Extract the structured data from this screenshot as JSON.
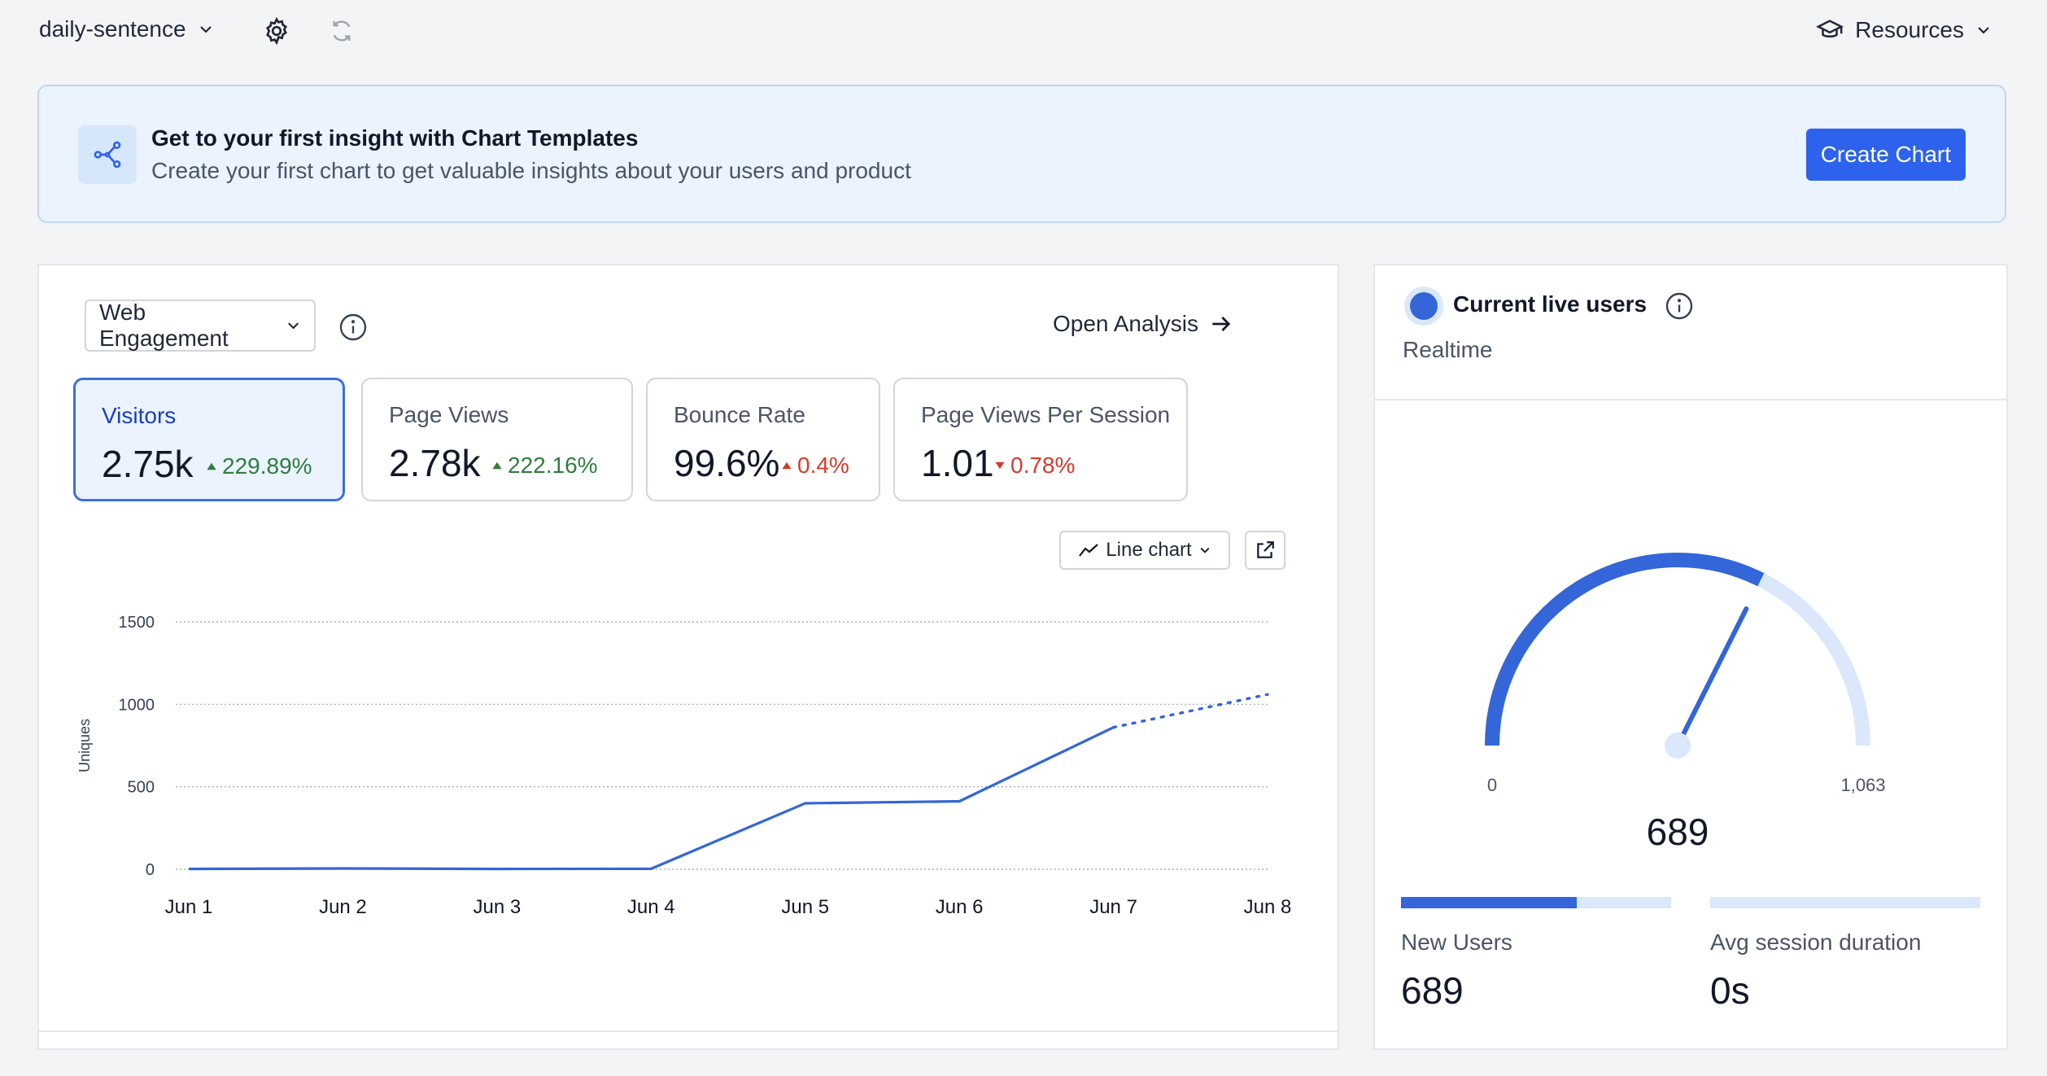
{
  "topbar": {
    "project_name": "daily-sentence",
    "resources_label": "Resources"
  },
  "banner": {
    "title": "Get to your first insight with Chart Templates",
    "subtitle": "Create your first chart to get valuable insights about your users and product",
    "button_label": "Create Chart"
  },
  "main": {
    "dropdown_label": "Web Engagement",
    "open_analysis_label": "Open Analysis",
    "metrics": [
      {
        "label": "Visitors",
        "value": "2.75k",
        "change": "229.89%",
        "direction": "up"
      },
      {
        "label": "Page Views",
        "value": "2.78k",
        "change": "222.16%",
        "direction": "up"
      },
      {
        "label": "Bounce Rate",
        "value": "99.6%",
        "change": "0.4%",
        "direction": "up"
      },
      {
        "label": "Page Views Per Session",
        "value": "1.01",
        "change": "0.78%",
        "direction": "down"
      }
    ],
    "chart_type_label": "Line chart"
  },
  "chart_data": {
    "type": "line",
    "title": "",
    "xlabel": "",
    "ylabel": "Uniques",
    "categories": [
      "Jun 1",
      "Jun 2",
      "Jun 3",
      "Jun 4",
      "Jun 5",
      "Jun 6",
      "Jun 7",
      "Jun 8"
    ],
    "yticks": [
      0,
      500,
      1000,
      1500
    ],
    "ylim": [
      0,
      1500
    ],
    "grid": true,
    "line_color": "#3465d9",
    "series": [
      {
        "values": [
          2,
          5,
          2,
          3,
          400,
          412,
          860,
          1060
        ],
        "projected_from_index": 6
      }
    ]
  },
  "side": {
    "title": "Current live users",
    "subtitle": "Realtime",
    "gauge": {
      "min_label": "0",
      "max_label": "1,063",
      "min": 0,
      "max": 1063,
      "value": 689,
      "value_label": "689"
    },
    "stats": [
      {
        "label": "New Users",
        "value": "689",
        "fill": 0.65
      },
      {
        "label": "Avg session duration",
        "value": "0s",
        "fill": 0
      }
    ]
  },
  "colors": {
    "accent": "#2d62ec",
    "series_blue": "#3465d9",
    "gauge_track": "#dbe8fb",
    "positive": "#2f7d3d",
    "negative": "#d23b2c"
  }
}
